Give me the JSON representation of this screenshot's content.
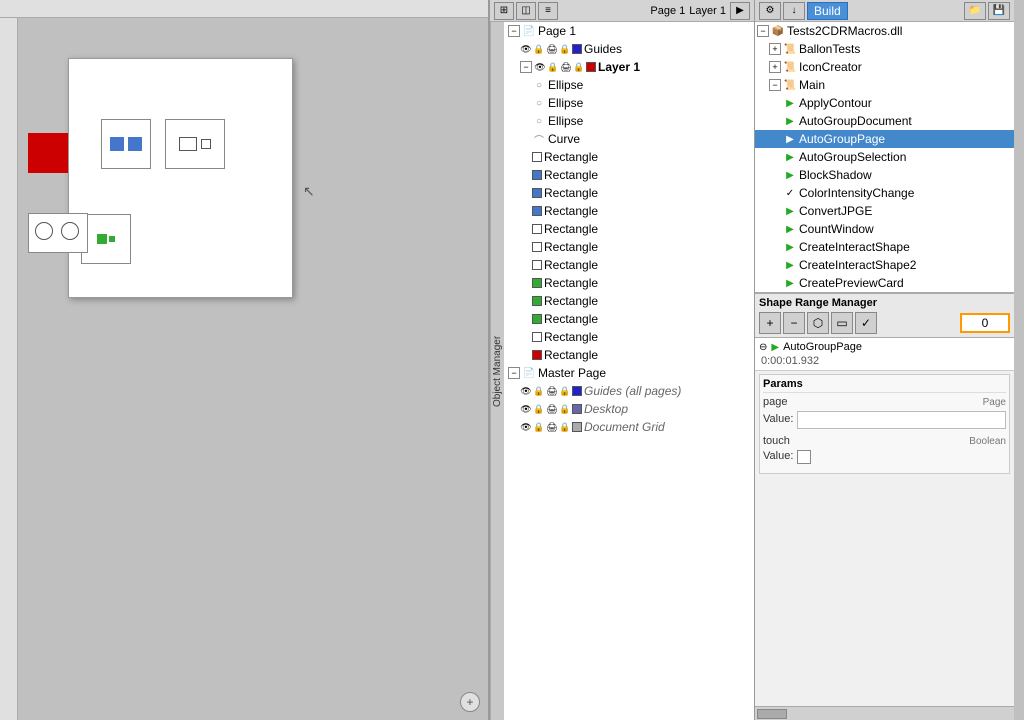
{
  "toolbar": {
    "page_label": "Page 1",
    "layer_label": "Layer 1",
    "build_label": "Build"
  },
  "canvas": {
    "plus_icon": "+"
  },
  "object_manager": {
    "label": "Object Manager",
    "page1_label": "Page 1",
    "guides_label": "Guides",
    "layer1_label": "Layer 1",
    "items": [
      {
        "label": "Ellipse",
        "indent": 5,
        "type": "ellipse"
      },
      {
        "label": "Ellipse",
        "indent": 5,
        "type": "ellipse"
      },
      {
        "label": "Ellipse",
        "indent": 5,
        "type": "ellipse"
      },
      {
        "label": "Curve",
        "indent": 5,
        "type": "curve"
      },
      {
        "label": "Rectangle",
        "indent": 5,
        "type": "rect_white"
      },
      {
        "label": "Rectangle",
        "indent": 5,
        "type": "rect_blue"
      },
      {
        "label": "Rectangle",
        "indent": 5,
        "type": "rect_blue"
      },
      {
        "label": "Rectangle",
        "indent": 5,
        "type": "rect_blue"
      },
      {
        "label": "Rectangle",
        "indent": 5,
        "type": "rect_white"
      },
      {
        "label": "Rectangle",
        "indent": 5,
        "type": "rect_white"
      },
      {
        "label": "Rectangle",
        "indent": 5,
        "type": "rect_white"
      },
      {
        "label": "Rectangle",
        "indent": 5,
        "type": "rect_green"
      },
      {
        "label": "Rectangle",
        "indent": 5,
        "type": "rect_green"
      },
      {
        "label": "Rectangle",
        "indent": 5,
        "type": "rect_green"
      },
      {
        "label": "Rectangle",
        "indent": 5,
        "type": "rect_white"
      },
      {
        "label": "Rectangle",
        "indent": 5,
        "type": "rect_red"
      }
    ],
    "master_page_label": "Master Page",
    "guides_all_pages_label": "Guides (all pages)",
    "desktop_label": "Desktop",
    "document_grid_label": "Document Grid"
  },
  "script_panel": {
    "dll_label": "Tests2CDRMacros.dll",
    "ballon_tests_label": "BallonTests",
    "icon_creator_label": "IconCreator",
    "main_label": "Main",
    "apply_contour_label": "ApplyContour",
    "auto_group_document_label": "AutoGroupDocument",
    "auto_group_page_label": "AutoGroupPage",
    "auto_group_selection_label": "AutoGroupSelection",
    "block_shadow_label": "BlockShadow",
    "color_intensity_change_label": "ColorIntensityChange",
    "convert_jpge_label": "ConvertJPGE",
    "count_window_label": "CountWindow",
    "create_interact_shape_label": "CreateInteractShape",
    "create_interact_shape2_label": "CreateInteractShape2",
    "create_preview_card_label": "CreatePreviewCard"
  },
  "shape_range_manager": {
    "title": "Shape Range Manager",
    "value": "0",
    "plus_icon": "+",
    "minus_icon": "−",
    "lasso_icon": "⬡",
    "rect_icon": "▭",
    "check_icon": "✓"
  },
  "result": {
    "function_name": "AutoGroupPage",
    "time": "0:00:01.932"
  },
  "params": {
    "title": "Params",
    "page_label": "page",
    "page_type": "Page",
    "page_value_label": "Value:",
    "page_value": "",
    "touch_label": "touch",
    "touch_type": "Boolean",
    "touch_value_label": "Value:"
  }
}
